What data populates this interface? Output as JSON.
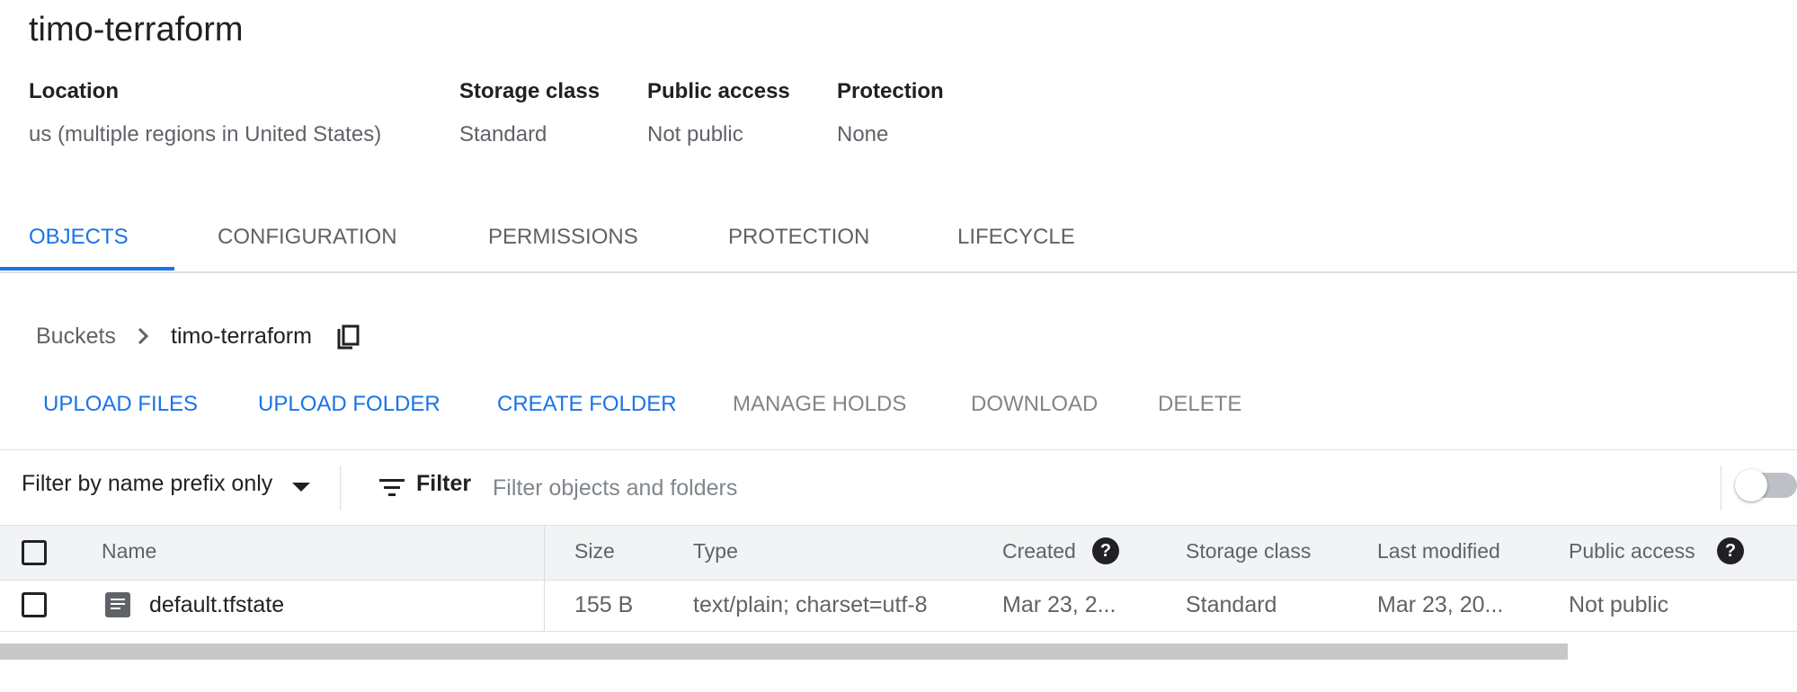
{
  "bucket": {
    "name": "timo-terraform",
    "meta": [
      {
        "label": "Location",
        "value": "us (multiple regions in United States)"
      },
      {
        "label": "Storage class",
        "value": "Standard"
      },
      {
        "label": "Public access",
        "value": "Not public"
      },
      {
        "label": "Protection",
        "value": "None"
      }
    ]
  },
  "tabs": [
    "OBJECTS",
    "CONFIGURATION",
    "PERMISSIONS",
    "PROTECTION",
    "LIFECYCLE"
  ],
  "active_tab": "OBJECTS",
  "breadcrumb": {
    "root": "Buckets",
    "current": "timo-terraform"
  },
  "actions": [
    {
      "label": "UPLOAD FILES",
      "enabled": true
    },
    {
      "label": "UPLOAD FOLDER",
      "enabled": true
    },
    {
      "label": "CREATE FOLDER",
      "enabled": true
    },
    {
      "label": "MANAGE HOLDS",
      "enabled": false
    },
    {
      "label": "DOWNLOAD",
      "enabled": false
    },
    {
      "label": "DELETE",
      "enabled": false
    }
  ],
  "filter": {
    "mode": "Filter by name prefix only",
    "button_label": "Filter",
    "placeholder": "Filter objects and folders",
    "toggle_on": false
  },
  "table": {
    "columns": [
      "Name",
      "Size",
      "Type",
      "Created",
      "Storage class",
      "Last modified",
      "Public access"
    ],
    "rows": [
      {
        "name": "default.tfstate",
        "size": "155 B",
        "type": "text/plain; charset=utf-8",
        "created": "Mar 23, 2...",
        "storage_class": "Standard",
        "last_modified": "Mar 23, 20...",
        "public_access": "Not public"
      }
    ]
  },
  "colors": {
    "accent": "#1a73e8",
    "text": "#202124",
    "muted": "#5f6368"
  },
  "icons": [
    "chevron-right-icon",
    "copy-icon",
    "dropdown-caret-icon",
    "filter-icon",
    "help-icon",
    "file-icon"
  ]
}
